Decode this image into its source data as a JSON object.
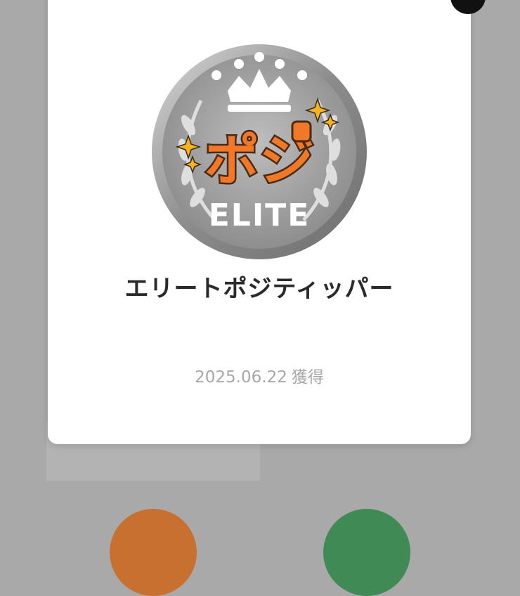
{
  "modal": {
    "badge": {
      "logo_text": "ポジ",
      "rank_text": "ELITE",
      "logo_color": "#f07828",
      "medal_color": "#9e9e9e"
    },
    "title": "エリートポジティッパー",
    "earned_date": "2025.06.22",
    "earned_label": "獲得"
  },
  "icons": {
    "close": "close-icon",
    "crown": "crown-icon",
    "laurel": "laurel-icon",
    "sparkle": "sparkle-icon",
    "fist": "fist-icon"
  }
}
